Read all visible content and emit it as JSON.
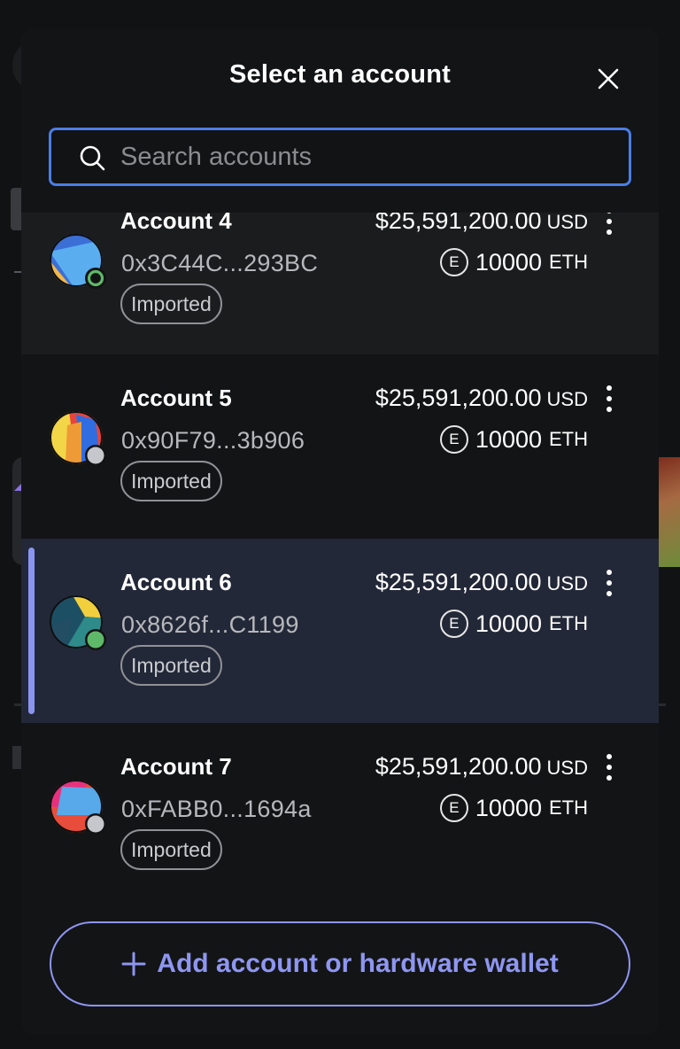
{
  "modal": {
    "title": "Select an account",
    "close_icon": "close-icon"
  },
  "search": {
    "placeholder": "Search accounts",
    "value": "",
    "icon": "search-icon",
    "border_color": "#4a7ee6"
  },
  "accounts": [
    {
      "name": "Account 4",
      "address": "0x3C44C...293BC",
      "badge": "Imported",
      "usd_amount": "$25,591,200.00",
      "usd_currency": "USD",
      "eth_symbol": "E",
      "eth_amount": "10000",
      "eth_currency": "ETH",
      "status": "connected-outline",
      "selected": false
    },
    {
      "name": "Account 5",
      "address": "0x90F79...3b906",
      "badge": "Imported",
      "usd_amount": "$25,591,200.00",
      "usd_currency": "USD",
      "eth_symbol": "E",
      "eth_amount": "10000",
      "eth_currency": "ETH",
      "status": "not-connected",
      "selected": false
    },
    {
      "name": "Account 6",
      "address": "0x8626f...C1199",
      "badge": "Imported",
      "usd_amount": "$25,591,200.00",
      "usd_currency": "USD",
      "eth_symbol": "E",
      "eth_amount": "10000",
      "eth_currency": "ETH",
      "status": "connected",
      "selected": true
    },
    {
      "name": "Account 7",
      "address": "0xFABB0...1694a",
      "badge": "Imported",
      "usd_amount": "$25,591,200.00",
      "usd_currency": "USD",
      "eth_symbol": "E",
      "eth_amount": "10000",
      "eth_currency": "ETH",
      "status": "not-connected",
      "selected": false
    }
  ],
  "footer": {
    "add_label": "Add account or hardware wallet",
    "add_icon": "plus-icon"
  },
  "colors": {
    "accent": "#8e96f1",
    "selected_row_bg": "#232838",
    "connected_green": "#5fb86a",
    "not_connected_grey": "#c6c7cc"
  }
}
